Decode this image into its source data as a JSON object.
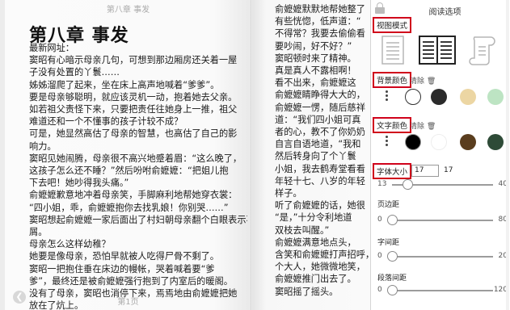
{
  "book": {
    "running_head": "第八章 事发",
    "chapter_title": "第八章 事发",
    "left_lines": [
      "最新网址：",
      "窦昭有心暗示母亲几句，可想到那边厢房还关着一屋",
      "子没有处置的丫鬟……",
      "姊姊溜爬了起来，坐在床上高声地喊着“爹爹”。",
      "要是母亲够聪明，就应该灵机一动，抱着她去父亲。",
      "如若祖父责怪下来，只要把责任往她身上一推，祖父",
      "难道还和一个不懂事的孩子计较不成？",
      "可是，她显然高估了母亲的智慧，也高估了自己的影",
      "响力。",
      "窦昭见她闹腾，母亲很不高兴地蹙着眉：“这么晚了，",
      "这孩子怎么还不睡？”然后吩咐俞嬷嬷：“把姐儿抱",
      "下去吧！她吵得我头痛。”",
      "俞嬷嬷歉意地冲着母亲笑，手脚麻利地帮她穿衣裳：",
      "“四小姐，乖，俞嬷嬷抱你去找乳娘！你别哭……”",
      "窦昭想起俞嬷嬷一家后面出了村妇朝母亲翻个白眼表示不",
      "屑。",
      "母亲怎么这样幼稚？",
      "她要是像母亲，恐怕早就被人吃得尸骨不剩了。",
      "窦昭一把抱住垂在床边的幔帐，哭着喊着要“爹",
      "爹”，最终还是被俞嬷嬷强行抱到了内室后的暖阁。",
      "没有了母亲，窦昭也消停下来，焉焉地由俞嬷嬷把她",
      "放在了炕上。"
    ],
    "right_lines": [
      "俞嬷嬷默默地帮她整了",
      "有些恍惚，低声道：“",
      "不得常？我要去偷偷看",
      "要吵闹，好不好？”",
      "窦昭顿时来了精神。",
      "真是真人不露相啊！",
      "看不出来，俞嬷嬷这",
      "俞嬷嬷睛睁得大大的，",
      "俞嬷嬷一愣，随后慈祥",
      "道：“我们四小姐可真",
      "者的心，教不了你奶奶",
      "自言自语地道，“我和",
      "然后转身向了个丫鬟",
      "小姐，我去鹤寿堂看看",
      "年轻十七、八岁的年轻",
      "样子。",
      "听了俞嬷嬷的话，她很",
      "“是，”十分令利地道",
      "双枝去叫醒。”",
      "俞嬷嬷满意地点头，",
      "含笑和俞嬷嬷打声招呼，",
      "个大人，她微微地笑，",
      "俞嬷嬷推门出去了。",
      "窦昭摇了摇头。"
    ],
    "footer": "第1页",
    "prev_icon": "chevron-left-icon"
  },
  "panel": {
    "title": "阅读选项",
    "view_mode": {
      "label": "视图模式",
      "modes": [
        "single-page-icon",
        "double-page-icon",
        "scroll-icon"
      ]
    },
    "bg_color": {
      "label": "背景颜色",
      "clear": "清除",
      "swatches": [
        "#ffffff",
        "#2b2b2b",
        "#ecd6a3",
        "#bde4c3"
      ]
    },
    "text_color": {
      "label": "文字颜色",
      "clear": "清除",
      "swatches": [
        "#000000",
        "#ffffff",
        "#5a3d1e",
        "#2e4b37"
      ]
    },
    "font_size": {
      "label": "字体大小",
      "input_value": "17",
      "display_value": "17",
      "min": "13",
      "max": "40",
      "value": 17
    },
    "margin": {
      "label": "页边距",
      "min": "0",
      "max": "80",
      "value": 0
    },
    "letter_spacing": {
      "label": "字间距",
      "min": "0",
      "max": "20",
      "value": 0
    },
    "paragraph_spacing": {
      "label": "段落间距",
      "min": "0",
      "max": "120",
      "value": 0
    }
  },
  "colors": {
    "highlight": "#d0021b",
    "icon": "#444444"
  }
}
